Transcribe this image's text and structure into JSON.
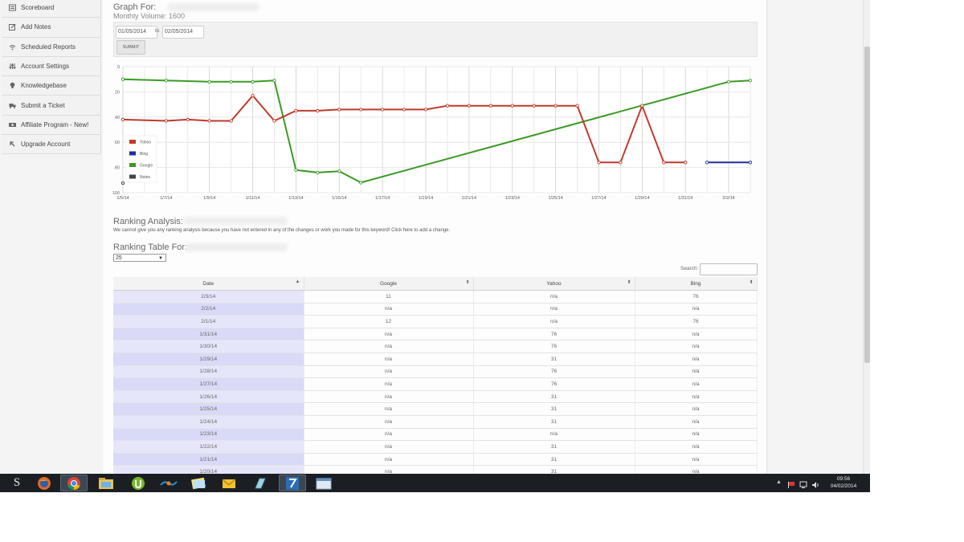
{
  "sidebar": {
    "items": [
      {
        "label": "Scoreboard",
        "icon": "list-icon"
      },
      {
        "label": "Add Notes",
        "icon": "edit-icon"
      },
      {
        "label": "Scheduled Reports",
        "icon": "wifi-icon"
      },
      {
        "label": "Account Settings",
        "icon": "sliders-icon"
      },
      {
        "label": "Knowledgebase",
        "icon": "bulb-icon"
      },
      {
        "label": "Submit a Ticket",
        "icon": "truck-icon"
      },
      {
        "label": "Affiliate Program - New!",
        "icon": "money-icon"
      },
      {
        "label": "Upgrade Account",
        "icon": "arrow-up-left-icon"
      }
    ]
  },
  "graph": {
    "title": "Graph For:",
    "monthly_volume": "Monthly Volume: 1600",
    "date_from": "01/05/2014",
    "to_label": "to",
    "date_to": "02/05/2014",
    "submit_label": "SUBMIT"
  },
  "chart_data": {
    "type": "line",
    "x": [
      "1/5/14",
      "1/6/14",
      "1/7/14",
      "1/8/14",
      "1/9/14",
      "1/10/14",
      "1/11/14",
      "1/12/14",
      "1/13/14",
      "1/14/14",
      "1/15/14",
      "1/16/14",
      "1/17/14",
      "1/18/14",
      "1/19/14",
      "1/20/14",
      "1/21/14",
      "1/22/14",
      "1/23/14",
      "1/24/14",
      "1/25/14",
      "1/26/14",
      "1/27/14",
      "1/28/14",
      "1/29/14",
      "1/30/14",
      "1/31/14",
      "2/1/14",
      "2/2/14",
      "2/3/14"
    ],
    "x_tick_labels": [
      "1/5/14",
      "1/7/14",
      "1/9/14",
      "1/11/14",
      "1/13/14",
      "1/15/14",
      "1/17/14",
      "1/19/14",
      "1/21/14",
      "1/23/14",
      "1/25/14",
      "1/27/14",
      "1/29/14",
      "1/31/14",
      "2/2/14"
    ],
    "ylim": [
      0,
      100
    ],
    "y_ticks": [
      0,
      20,
      40,
      60,
      80,
      100
    ],
    "y_inverted": true,
    "grid": true,
    "legend_position": "bottom-left",
    "legend": [
      "Yahoo",
      "Bing",
      "Google",
      "Notes"
    ],
    "colors": {
      "Yahoo": "#c0392b",
      "Bing": "#1f2f9c",
      "Google": "#3a9b22",
      "Notes": "#444444"
    },
    "series": [
      {
        "name": "Google",
        "points": [
          [
            "1/5/14",
            10
          ],
          [
            "1/7/14",
            11
          ],
          [
            "1/9/14",
            12
          ],
          [
            "1/10/14",
            12
          ],
          [
            "1/11/14",
            12
          ],
          [
            "1/12/14",
            11
          ],
          [
            "1/13/14",
            82
          ],
          [
            "1/14/14",
            84
          ],
          [
            "1/15/14",
            83
          ],
          [
            "1/16/14",
            92
          ],
          [
            "2/2/14",
            12
          ],
          [
            "2/3/14",
            11
          ]
        ]
      },
      {
        "name": "Yahoo",
        "points": [
          [
            "1/5/14",
            42
          ],
          [
            "1/7/14",
            43
          ],
          [
            "1/8/14",
            42
          ],
          [
            "1/9/14",
            43
          ],
          [
            "1/10/14",
            43
          ],
          [
            "1/11/14",
            23
          ],
          [
            "1/12/14",
            43
          ],
          [
            "1/13/14",
            35
          ],
          [
            "1/14/14",
            35
          ],
          [
            "1/15/14",
            34
          ],
          [
            "1/16/14",
            34
          ],
          [
            "1/17/14",
            34
          ],
          [
            "1/18/14",
            34
          ],
          [
            "1/19/14",
            34
          ],
          [
            "1/20/14",
            31
          ],
          [
            "1/21/14",
            31
          ],
          [
            "1/22/14",
            31
          ],
          [
            "1/23/14",
            31
          ],
          [
            "1/24/14",
            31
          ],
          [
            "1/25/14",
            31
          ],
          [
            "1/26/14",
            31
          ],
          [
            "1/27/14",
            76
          ],
          [
            "1/28/14",
            76
          ],
          [
            "1/29/14",
            31
          ],
          [
            "1/30/14",
            76
          ],
          [
            "1/31/14",
            76
          ]
        ]
      },
      {
        "name": "Bing",
        "points": [
          [
            "2/1/14",
            76
          ],
          [
            "2/3/14",
            76
          ]
        ]
      }
    ]
  },
  "analysis": {
    "title": "Ranking Analysis:",
    "message": "We cannot give you any ranking analysis because you have not entered in any of the changes or work you made for this keyword! Click here to add a change."
  },
  "table": {
    "title": "Ranking Table For:",
    "page_size": "25",
    "search_label": "Search:",
    "headers": [
      "Date",
      "Google",
      "Yahoo",
      "Bing"
    ],
    "rows": [
      [
        "2/3/14",
        "11",
        "n/a",
        "76"
      ],
      [
        "2/2/14",
        "n/a",
        "n/a",
        "n/a"
      ],
      [
        "2/1/14",
        "12",
        "n/a",
        "76"
      ],
      [
        "1/31/14",
        "n/a",
        "76",
        "n/a"
      ],
      [
        "1/30/14",
        "n/a",
        "76",
        "n/a"
      ],
      [
        "1/29/14",
        "n/a",
        "31",
        "n/a"
      ],
      [
        "1/28/14",
        "n/a",
        "76",
        "n/a"
      ],
      [
        "1/27/14",
        "n/a",
        "76",
        "n/a"
      ],
      [
        "1/26/14",
        "n/a",
        "31",
        "n/a"
      ],
      [
        "1/25/14",
        "n/a",
        "31",
        "n/a"
      ],
      [
        "1/24/14",
        "n/a",
        "31",
        "n/a"
      ],
      [
        "1/23/14",
        "n/a",
        "n/a",
        "n/a"
      ],
      [
        "1/22/14",
        "n/a",
        "31",
        "n/a"
      ],
      [
        "1/21/14",
        "n/a",
        "31",
        "n/a"
      ],
      [
        "1/20/14",
        "n/a",
        "31",
        "n/a"
      ]
    ]
  },
  "taskbar": {
    "apps": [
      "start-button",
      "firefox-icon",
      "chrome-icon",
      "file-explorer-icon",
      "utorrent-icon",
      "network-tool-icon",
      "sticky-notes-icon",
      "outlook-icon",
      "app-icon",
      "filezilla-icon",
      "window-icon"
    ],
    "time": "09:56",
    "date": "04/02/2014"
  }
}
